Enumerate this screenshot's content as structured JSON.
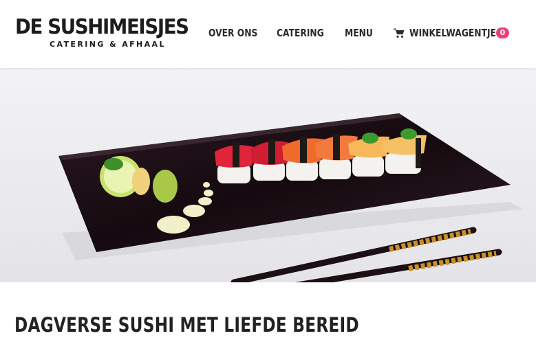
{
  "header": {
    "logo": {
      "title": "DE SUSHIMEISJES",
      "subtitle": "CATERING & AFHAAL"
    },
    "nav": [
      {
        "label": "OVER ONS"
      },
      {
        "label": "CATERING"
      },
      {
        "label": "MENU"
      }
    ],
    "cart": {
      "label": "WINKELWAGENTJE",
      "count": "0",
      "icon": "shopping-cart-icon"
    }
  },
  "hero": {
    "image": "sushi-platter-photo"
  },
  "main": {
    "heading": "DAGVERSE SUSHI MET LIEFDE BEREID"
  },
  "colors": {
    "accent": "#e8407a",
    "text": "#222222",
    "plate": "#1a0f14"
  }
}
